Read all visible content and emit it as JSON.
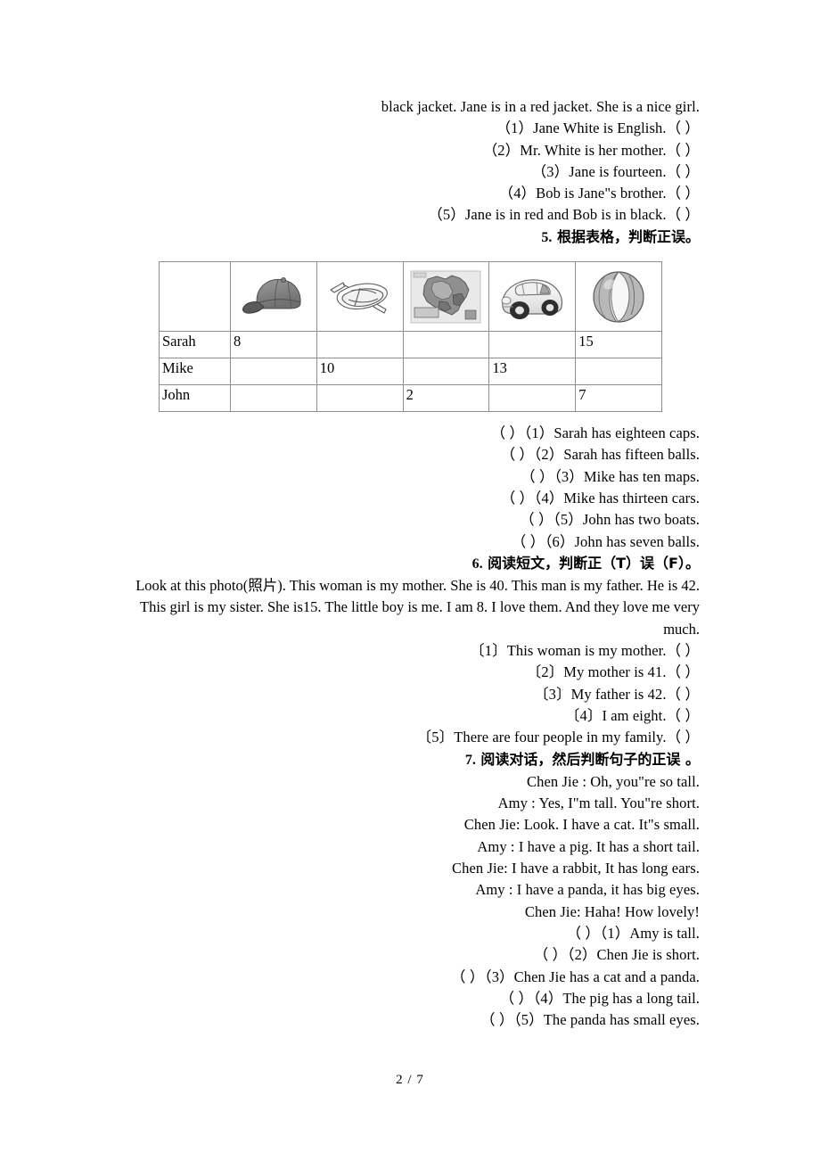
{
  "document": {
    "footer_page": "2 / 7"
  },
  "section4_tail": {
    "passage_line": "black jacket. Jane is in a red jacket. She is a nice girl.",
    "questions": [
      "（1）Jane White is English.（  ）",
      "（2）Mr. White is her mother.（  ）",
      "（3）Jane is fourteen.（  ）",
      "（4）Bob is Jane\"s brother.（  ）",
      "（5）Jane is in red and Bob is in black.（  ）"
    ]
  },
  "section5": {
    "number": "5.",
    "heading": "根据表格，判断正误。",
    "table": {
      "column_icons": [
        "cap-icon",
        "boat-icon",
        "map-icon",
        "car-icon",
        "ball-icon"
      ],
      "rows": [
        {
          "name": "Sarah",
          "values": [
            "8",
            "",
            "",
            "",
            "15"
          ]
        },
        {
          "name": "Mike",
          "values": [
            "",
            "10",
            "",
            "13",
            ""
          ]
        },
        {
          "name": "John",
          "values": [
            "",
            "",
            "2",
            "",
            "7"
          ]
        }
      ]
    },
    "questions": [
      "（  ）（1）Sarah has eighteen caps.",
      "（  ）（2）Sarah has fifteen balls.",
      "（  ）（3）Mike has ten maps.",
      "（  ）（4）Mike has thirteen cars.",
      "（  ）（5）John has two boats.",
      "（  ）（6）John has seven balls."
    ]
  },
  "section6": {
    "number": "6.",
    "heading": "阅读短文，判断正（T）误（F）。",
    "passage": "Look at this photo(照片). This woman is my mother. She is 40. This man is my father. He is 42. This girl is my sister. She is15. The little boy is me. I am 8. I love them. And they love me very much.",
    "questions": [
      "〔1〕This woman is my mother.（  ）",
      "〔2〕My mother is 41.（  ）",
      "〔3〕My father is 42.（  ）",
      "〔4〕I am eight.（  ）",
      "〔5〕There are four people in my family.（  ）"
    ]
  },
  "section7": {
    "number": "7.",
    "heading": "阅读对话，然后判断句子的正误 。",
    "dialogue": [
      "Chen Jie : Oh, you\"re so tall.",
      "Amy : Yes, I\"m tall. You\"re short.",
      "Chen Jie: Look. I have a cat. It\"s small.",
      "Amy : I have a pig. It has a short tail.",
      "Chen Jie: I have a rabbit, It has long ears.",
      "Amy : I have a panda, it has big eyes.",
      "Chen Jie: Haha! How lovely!"
    ],
    "questions": [
      "（  ）（1）Amy is tall.",
      "（  ）（2）Chen Jie is short.",
      "（  ）（3）Chen Jie has a cat and a panda.",
      "（  ）（4）The pig has a long tail.",
      "（  ）（5）The panda has small eyes."
    ]
  }
}
